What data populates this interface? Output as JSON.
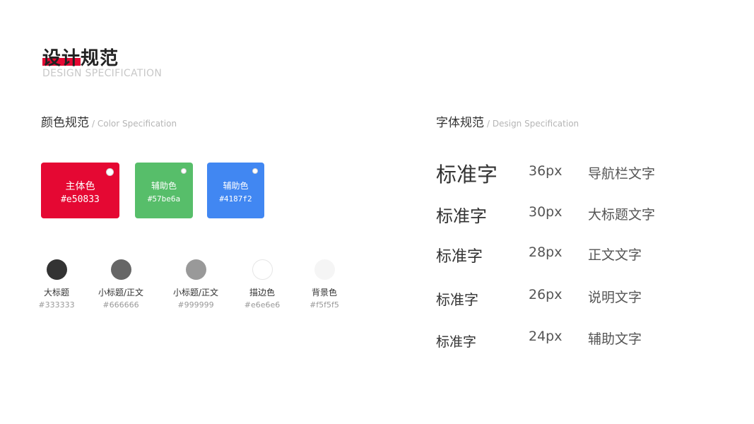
{
  "header": {
    "title": "设计规范",
    "subtitle": "DESIGN SPECIFICATION"
  },
  "colors_section": {
    "heading": "颜色规范",
    "subheading": "/ Color Specification",
    "swatches": [
      {
        "name": "主体色",
        "hex": "#e50833",
        "color": "#e50833"
      },
      {
        "name": "辅助色",
        "hex": "#57be6a",
        "color": "#57be6a"
      },
      {
        "name": "辅助色",
        "hex": "#4187f2",
        "color": "#4187f2"
      }
    ],
    "neutrals": [
      {
        "label": "大标题",
        "hex": "#333333",
        "color": "#333333"
      },
      {
        "label": "小标题/正文",
        "hex": "#666666",
        "color": "#666666"
      },
      {
        "label": "小标题/正文",
        "hex": "#999999",
        "color": "#999999"
      },
      {
        "label": "描边色",
        "hex": "#e6e6e6",
        "color": "#e6e6e6"
      },
      {
        "label": "背景色",
        "hex": "#f5f5f5",
        "color": "#f5f5f5"
      }
    ]
  },
  "fonts_section": {
    "heading": "字体规范",
    "subheading": "/ Design Specification",
    "rows": [
      {
        "sample": "标准字",
        "size": "36px",
        "usage": "导航栏文字"
      },
      {
        "sample": "标准字",
        "size": "30px",
        "usage": "大标题文字"
      },
      {
        "sample": "标准字",
        "size": "28px",
        "usage": "正文文字"
      },
      {
        "sample": "标准字",
        "size": "26px",
        "usage": "说明文字"
      },
      {
        "sample": "标准字",
        "size": "24px",
        "usage": "辅助文字"
      }
    ]
  },
  "colors": {
    "accent": "#e50833"
  }
}
